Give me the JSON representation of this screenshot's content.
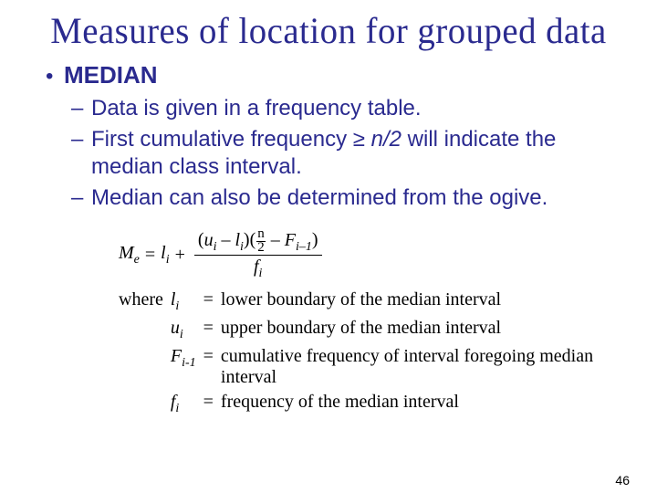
{
  "title": "Measures of location for grouped data",
  "bullet": "MEDIAN",
  "subs": {
    "s1": "Data is given in a frequency table.",
    "s2a": "First cumulative frequency ≥ ",
    "s2b": "n/2",
    "s2c": " will indicate the median class interval.",
    "s3": "Median can also be determined from the ogive."
  },
  "formula": {
    "lhs_var": "M",
    "lhs_sub": "e",
    "eq": " = ",
    "li_var": "l",
    "li_sub": "i",
    "plus": " + ",
    "num_open": "(",
    "u_var": "u",
    "u_sub": "i",
    "minus": " – ",
    "l2_var": "l",
    "l2_sub": "i",
    "num_mid": ")(",
    "n_top": "n",
    "n_bot": "2",
    "minus2": " – ",
    "F_var": "F",
    "F_sub": "i–1",
    "num_close": ")",
    "den_var": "f",
    "den_sub": "i"
  },
  "defs": {
    "where": "where",
    "r1_sym_v": "l",
    "r1_sym_s": "i",
    "r1_desc": "lower boundary of the median interval",
    "r2_sym_v": "u",
    "r2_sym_s": "i",
    "r2_desc": "upper boundary of the median interval",
    "r3_sym_v": "F",
    "r3_sym_s": "i-1",
    "r3_desc": "cumulative frequency of interval foregoing median interval",
    "r4_sym_v": "f",
    "r4_sym_s": "i",
    "r4_desc": "frequency of the median interval",
    "eq": "="
  },
  "page": "46"
}
